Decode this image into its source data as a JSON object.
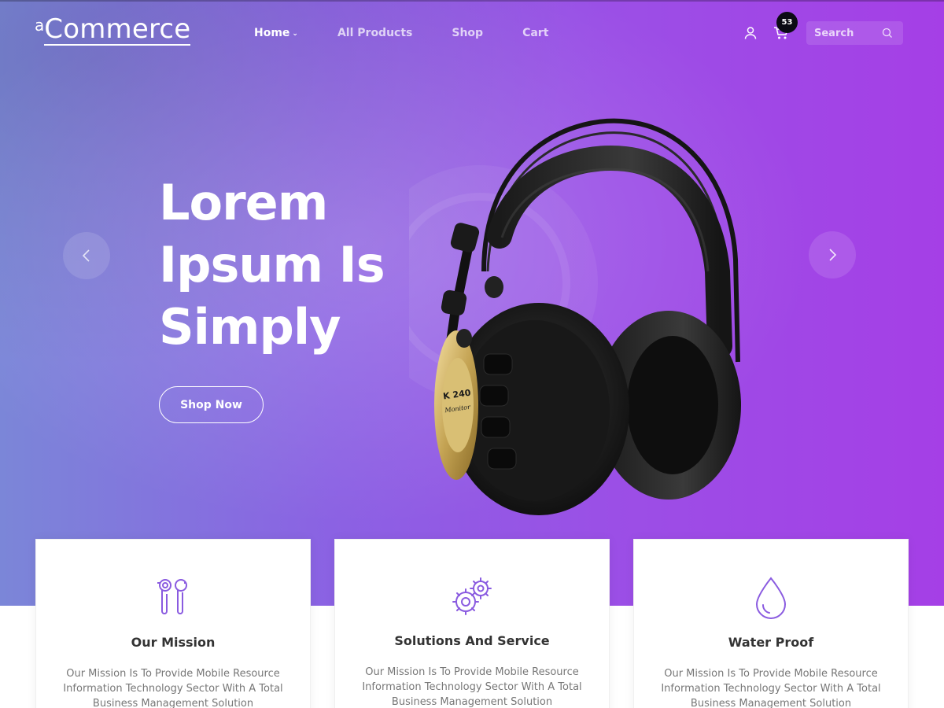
{
  "brand": {
    "logo_small": "a",
    "logo_main": "Commerce"
  },
  "nav": {
    "items": [
      {
        "label": "Home",
        "active": true,
        "has_dropdown": true
      },
      {
        "label": "All Products",
        "active": false
      },
      {
        "label": "Shop",
        "active": false
      },
      {
        "label": "Cart",
        "active": false
      }
    ]
  },
  "header": {
    "cart_count": "53",
    "search_placeholder": "Search",
    "icons": [
      "user-icon",
      "cart-icon",
      "search-icon"
    ]
  },
  "hero": {
    "title": "Lorem Ipsum Is Simply",
    "button_label": "Shop Now",
    "product_label": "K 240 Monitor",
    "arrows": [
      "chevron-left-icon",
      "chevron-right-icon"
    ]
  },
  "features": [
    {
      "icon": "earbuds-icon",
      "title": "Our Mission",
      "text": "Our Mission Is To Provide Mobile Resource Information Technology Sector With A Total Business Management Solution"
    },
    {
      "icon": "gears-icon",
      "title": "Solutions And Service",
      "text": "Our Mission Is To Provide Mobile Resource Information Technology Sector With A Total Business Management Solution"
    },
    {
      "icon": "water-drop-icon",
      "title": "Water Proof",
      "text": "Our Mission Is To Provide Mobile Resource Information Technology Sector With A Total Business Management Solution"
    }
  ],
  "colors": {
    "hero_gradient_start": "#7b86d8",
    "hero_gradient_end": "#a53fe6",
    "icon_purple": "#8a5be0",
    "badge": "#0b0b14"
  }
}
